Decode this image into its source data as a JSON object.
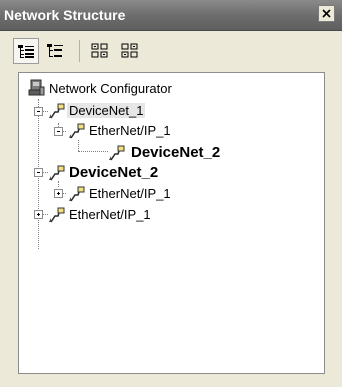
{
  "window": {
    "title": "Network Structure"
  },
  "toolbar": {
    "buttons": [
      {
        "icon": "tree-expand-all-icon",
        "active": true
      },
      {
        "icon": "tree-collapse-all-icon",
        "active": false
      },
      {
        "icon": "device-grid-icon",
        "active": false
      },
      {
        "icon": "device-grid-alt-icon",
        "active": false
      }
    ]
  },
  "tree": {
    "root": {
      "label": "Network Configurator",
      "icon": "network-configurator-icon"
    },
    "nodes": [
      {
        "label": "DeviceNet_1",
        "icon": "network-plug-icon",
        "expander": "minus",
        "selected": true,
        "bold": false
      },
      {
        "label": "EtherNet/IP_1",
        "icon": "network-plug-icon",
        "expander": "minus",
        "selected": false,
        "bold": false
      },
      {
        "label": "DeviceNet_2",
        "icon": "network-plug-icon",
        "expander": "none",
        "selected": false,
        "bold": true
      },
      {
        "label": "DeviceNet_2",
        "icon": "network-plug-icon",
        "expander": "minus",
        "selected": false,
        "bold": true
      },
      {
        "label": "EtherNet/IP_1",
        "icon": "network-plug-icon",
        "expander": "plus",
        "selected": false,
        "bold": false
      },
      {
        "label": "EtherNet/IP_1",
        "icon": "network-plug-icon",
        "expander": "plus",
        "selected": false,
        "bold": false
      }
    ]
  }
}
